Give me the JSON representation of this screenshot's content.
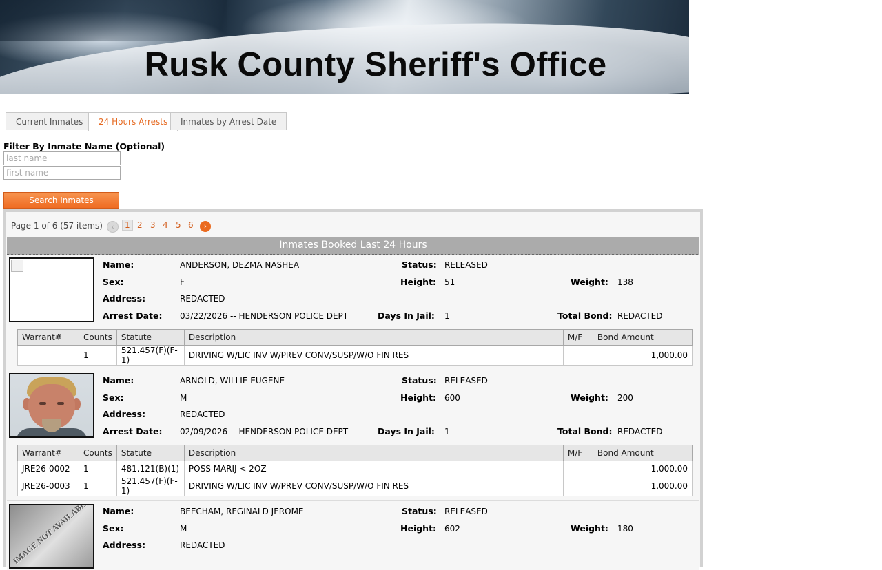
{
  "banner": {
    "title": "Rusk County Sheriff's Office"
  },
  "tabs": [
    {
      "label": "Current Inmates",
      "active": false
    },
    {
      "label": "24 Hours Arrests",
      "active": true
    },
    {
      "label": "Inmates by Arrest Date",
      "active": false
    }
  ],
  "filter": {
    "label": "Filter By Inmate Name (Optional)",
    "last_name_placeholder": "last name",
    "first_name_placeholder": "first name",
    "search_label": "Search Inmates"
  },
  "pager": {
    "info": "Page 1 of 6 (57 items)",
    "pages": [
      "1",
      "2",
      "3",
      "4",
      "5",
      "6"
    ],
    "current": "1",
    "prev_icon": "chevron-left-icon",
    "next_icon": "chevron-right-icon"
  },
  "grid": {
    "header": "Inmates Booked Last 24 Hours"
  },
  "labels": {
    "name": "Name:",
    "sex": "Sex:",
    "address": "Address:",
    "arrest_date": "Arrest Date:",
    "status": "Status:",
    "height": "Height:",
    "days_in_jail": "Days In Jail:",
    "weight": "Weight:",
    "total_bond": "Total Bond:"
  },
  "warrant_columns": [
    "Warrant#",
    "Counts",
    "Statute",
    "Description",
    "M/F",
    "Bond Amount"
  ],
  "inmates": [
    {
      "name": "ANDERSON, DEZMA NASHEA",
      "status": "RELEASED",
      "sex": "F",
      "height": "51",
      "weight": "138",
      "address": "REDACTED",
      "arrest_date": "03/22/2026 -- HENDERSON POLICE DEPT",
      "days_in_jail": "1",
      "total_bond": "REDACTED",
      "photo": "broken-image",
      "warrants": [
        {
          "warrant": "",
          "counts": "1",
          "statute": "521.457(F)(F-1)",
          "description": "DRIVING W/LIC INV W/PREV CONV/SUSP/W/O FIN RES",
          "mf": "",
          "bond": "1,000.00"
        }
      ]
    },
    {
      "name": "ARNOLD, WILLIE EUGENE",
      "status": "RELEASED",
      "sex": "M",
      "height": "600",
      "weight": "200",
      "address": "REDACTED",
      "arrest_date": "02/09/2026 -- HENDERSON POLICE DEPT",
      "days_in_jail": "1",
      "total_bond": "REDACTED",
      "photo": "mugshot",
      "warrants": [
        {
          "warrant": "JRE26-0002",
          "counts": "1",
          "statute": "481.121(B)(1)",
          "description": "POSS MARIJ < 2OZ",
          "mf": "",
          "bond": "1,000.00"
        },
        {
          "warrant": "JRE26-0003",
          "counts": "1",
          "statute": "521.457(F)(F-1)",
          "description": "DRIVING W/LIC INV W/PREV CONV/SUSP/W/O FIN RES",
          "mf": "",
          "bond": "1,000.00"
        }
      ]
    },
    {
      "name": "BEECHAM, REGINALD JEROME",
      "status": "RELEASED",
      "sex": "M",
      "height": "602",
      "weight": "180",
      "address": "REDACTED",
      "photo": "image-not-available",
      "photo_text": "IMAGE NOT AVAILABLE"
    }
  ]
}
